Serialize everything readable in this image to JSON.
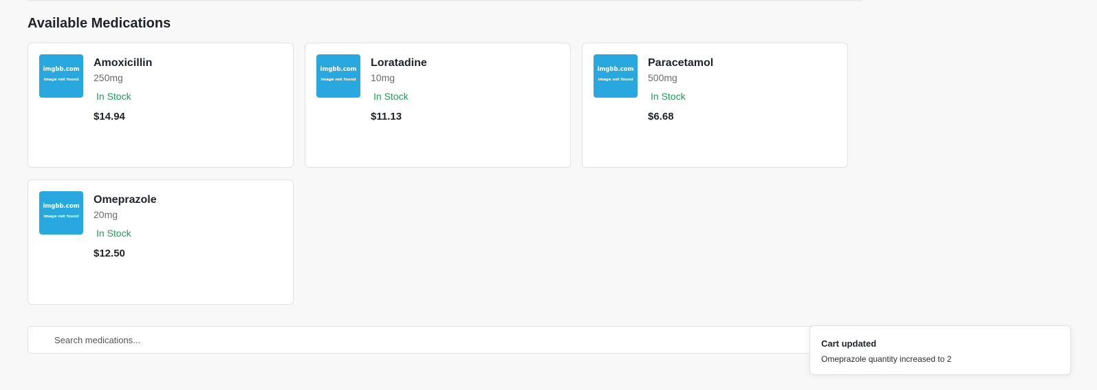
{
  "section": {
    "title": "Available Medications"
  },
  "medications": [
    {
      "name": "Amoxicillin",
      "dose": "250mg",
      "stock": "In Stock",
      "price": "$14.94",
      "image_text_1": "imgbb.com",
      "image_text_2": "image not found"
    },
    {
      "name": "Loratadine",
      "dose": "10mg",
      "stock": "In Stock",
      "price": "$11.13",
      "image_text_1": "imgbb.com",
      "image_text_2": "image not found"
    },
    {
      "name": "Paracetamol",
      "dose": "500mg",
      "stock": "In Stock",
      "price": "$6.68",
      "image_text_1": "imgbb.com",
      "image_text_2": "image not found"
    },
    {
      "name": "Omeprazole",
      "dose": "20mg",
      "stock": "In Stock",
      "price": "$12.50",
      "image_text_1": "imgbb.com",
      "image_text_2": "image not found"
    }
  ],
  "search": {
    "placeholder": "Search medications...",
    "icon": "search-icon"
  },
  "toast": {
    "title": "Cart updated",
    "message": "Omeprazole quantity increased to 2"
  },
  "colors": {
    "background": "#f8f8f8",
    "card": "#ffffff",
    "stock_green": "#1f9d55",
    "image_placeholder": "#29a8e0",
    "text_primary": "#1f2328",
    "text_muted": "#6b6b6b"
  }
}
